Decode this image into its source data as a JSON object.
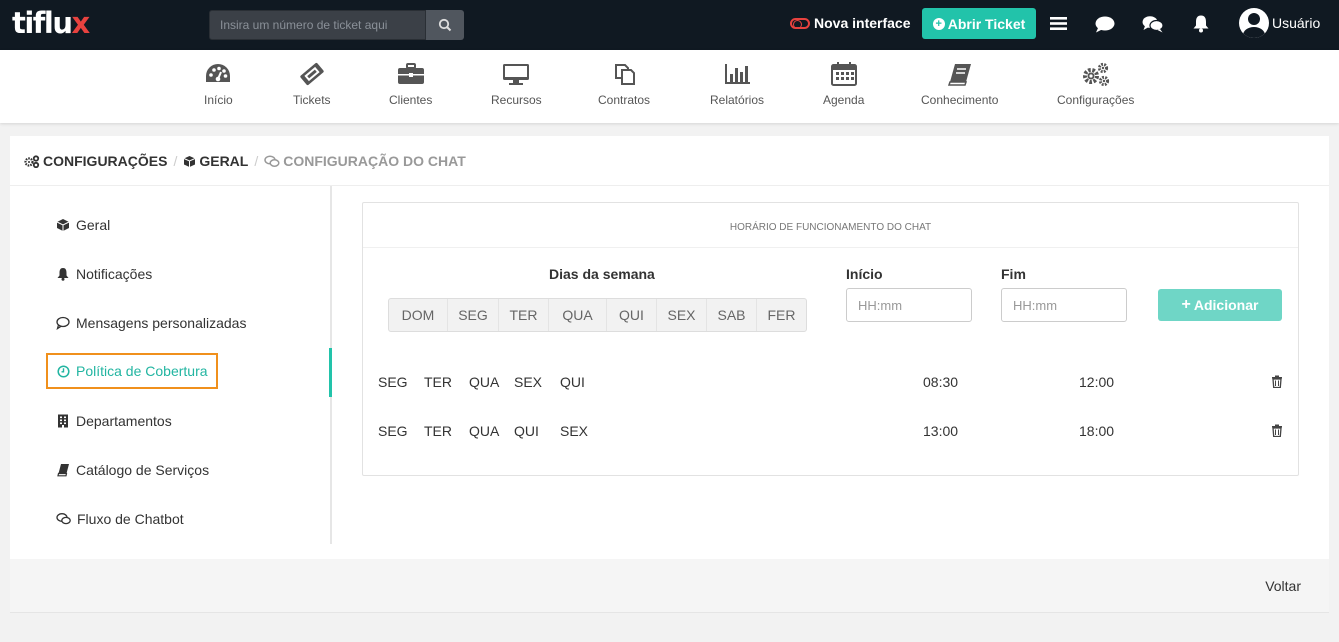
{
  "header": {
    "logo_main": "tiflu",
    "logo_accent": "x",
    "search_placeholder": "Insira um número de ticket aqui",
    "nova_interface": "Nova interface",
    "abrir_ticket": "Abrir Ticket",
    "user_name": "Usuário"
  },
  "nav": {
    "items": [
      {
        "label": "Início",
        "icon": "dashboard-icon"
      },
      {
        "label": "Tickets",
        "icon": "ticket-icon"
      },
      {
        "label": "Clientes",
        "icon": "briefcase-icon"
      },
      {
        "label": "Recursos",
        "icon": "monitor-icon"
      },
      {
        "label": "Contratos",
        "icon": "documents-icon"
      },
      {
        "label": "Relatórios",
        "icon": "bar-chart-icon"
      },
      {
        "label": "Agenda",
        "icon": "calendar-icon"
      },
      {
        "label": "Conhecimento",
        "icon": "book-icon"
      },
      {
        "label": "Configurações",
        "icon": "gears-icon"
      }
    ]
  },
  "breadcrumb": {
    "level1": "CONFIGURAÇÕES",
    "level2": "GERAL",
    "level3": "CONFIGURAÇÃO DO CHAT"
  },
  "sidebar": {
    "items": [
      {
        "label": "Geral",
        "icon": "cube-icon"
      },
      {
        "label": "Notificações",
        "icon": "bell-icon"
      },
      {
        "label": "Mensagens personalizadas",
        "icon": "comment-icon"
      },
      {
        "label": "Política de Cobertura",
        "icon": "clock-icon",
        "active": true
      },
      {
        "label": "Departamentos",
        "icon": "building-icon"
      },
      {
        "label": "Catálogo de Serviços",
        "icon": "book-icon"
      },
      {
        "label": "Fluxo de Chatbot",
        "icon": "comments-icon"
      }
    ]
  },
  "schedule": {
    "title": "HORÁRIO DE FUNCIONAMENTO DO CHAT",
    "days_label": "Dias da semana",
    "start_label": "Início",
    "end_label": "Fim",
    "days": [
      "DOM",
      "SEG",
      "TER",
      "QUA",
      "QUI",
      "SEX",
      "SAB",
      "FER"
    ],
    "start_placeholder": "HH:mm",
    "end_placeholder": "HH:mm",
    "add_button": "Adicionar",
    "rows": [
      {
        "days": [
          "SEG",
          "TER",
          "QUA",
          "SEX",
          "QUI"
        ],
        "start": "08:30",
        "end": "12:00"
      },
      {
        "days": [
          "SEG",
          "TER",
          "QUA",
          "QUI",
          "SEX"
        ],
        "start": "13:00",
        "end": "18:00"
      }
    ]
  },
  "footer": {
    "back": "Voltar"
  },
  "colors": {
    "topbar": "#101922",
    "accent": "#22c3aa",
    "active_outline": "#f0901c",
    "logo_x": "#e8423f"
  }
}
